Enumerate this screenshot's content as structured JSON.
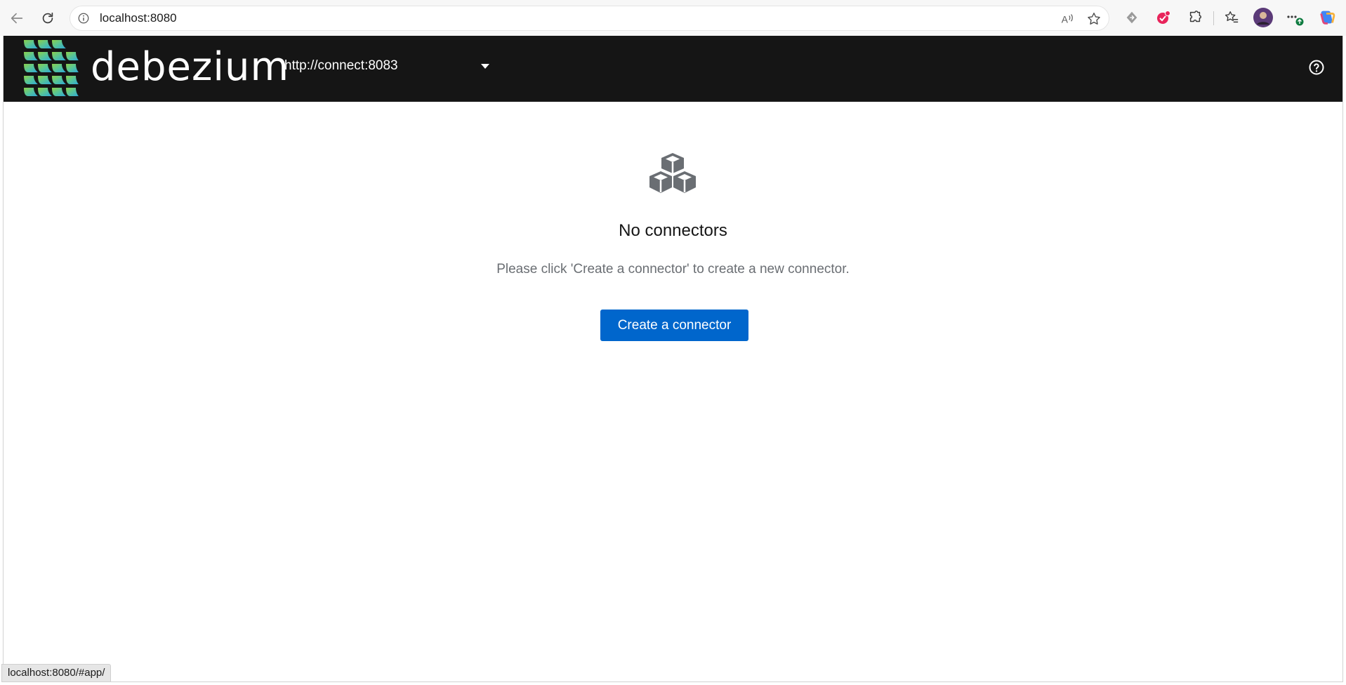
{
  "browser": {
    "url": "localhost:8080",
    "status_url": "localhost:8080/#app/"
  },
  "masthead": {
    "brand": "debezium",
    "cluster_selected": "http://connect:8083"
  },
  "empty_state": {
    "title": "No connectors",
    "body": "Please click 'Create a connector' to create a new connector.",
    "action_label": "Create a connector"
  },
  "colors": {
    "masthead_bg": "#151515",
    "primary": "#0066cc",
    "body_text": "#6a6e73"
  },
  "icons": {
    "empty_state": "cubes-icon",
    "help": "help-circle-icon"
  }
}
